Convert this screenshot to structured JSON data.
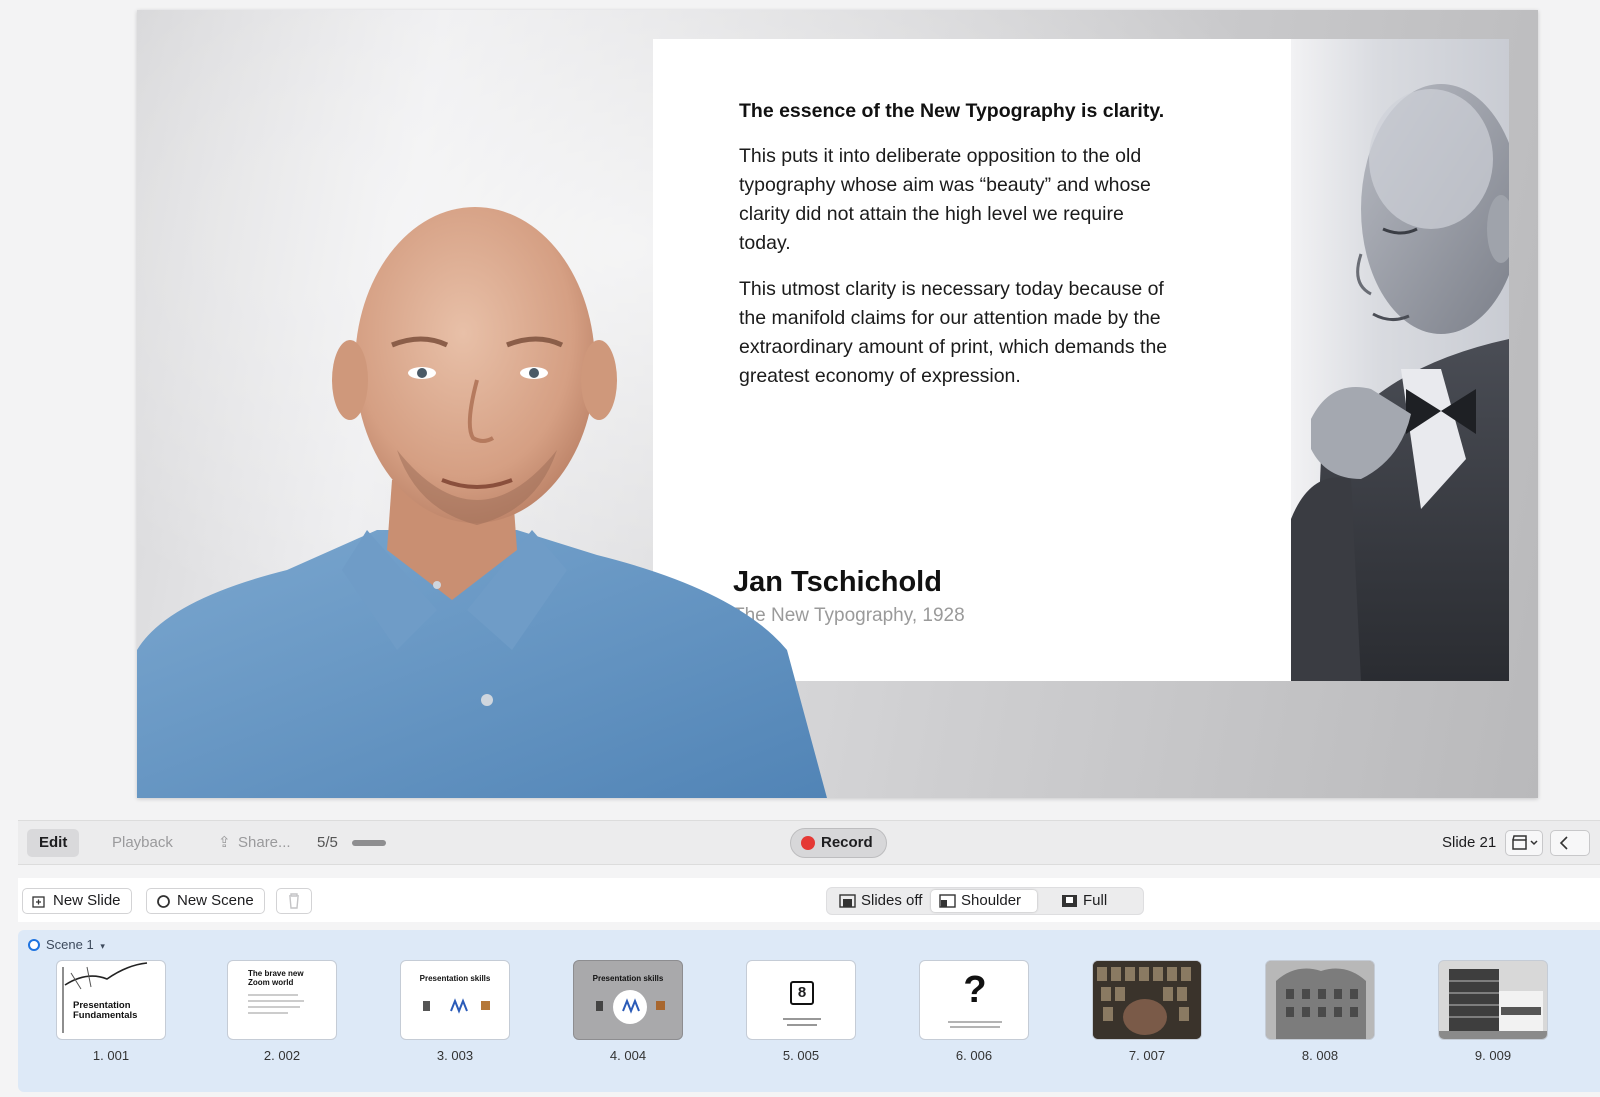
{
  "slide": {
    "quote_heading": "The essence of the New Typography is clarity.",
    "quote_paragraphs": [
      "This puts it into deliberate opposition to the old typography whose aim was “beauty” and whose clarity did not attain the high level we require today.",
      "This utmost clarity is necessary today because of the manifold claims for our attention made by the extraordinary amount of print, which demands the greatest economy of expression."
    ],
    "author": "Jan Tschichold",
    "source": "The New Typography, 1928"
  },
  "controls": {
    "edit": "Edit",
    "playback": "Playback",
    "share": "Share...",
    "counter": "5/5",
    "record": "Record",
    "slide_label": "Slide 21"
  },
  "toolbar": {
    "new_slide": "New Slide",
    "new_scene": "New Scene",
    "layout_off": "Slides off",
    "layout_shoulder": "Shoulder",
    "layout_full": "Full",
    "selected_layout": "Shoulder"
  },
  "scene": {
    "name": "Scene 1",
    "slides": [
      {
        "caption": "1. 001",
        "text": "Presentation Fundamentals"
      },
      {
        "caption": "2. 002",
        "text": "The brave new Zoom world"
      },
      {
        "caption": "3. 003",
        "text": "Presentation skills"
      },
      {
        "caption": "4. 004",
        "text": "Presentation skills"
      },
      {
        "caption": "5. 005",
        "text": "8"
      },
      {
        "caption": "6. 006",
        "text": "?"
      },
      {
        "caption": "7. 007",
        "text": ""
      },
      {
        "caption": "8. 008",
        "text": ""
      },
      {
        "caption": "9. 009",
        "text": ""
      }
    ],
    "selected_index": 3
  },
  "colors": {
    "record": "#e53935",
    "scene_strip": "#dde9f7",
    "accent": "#1f74e0"
  }
}
